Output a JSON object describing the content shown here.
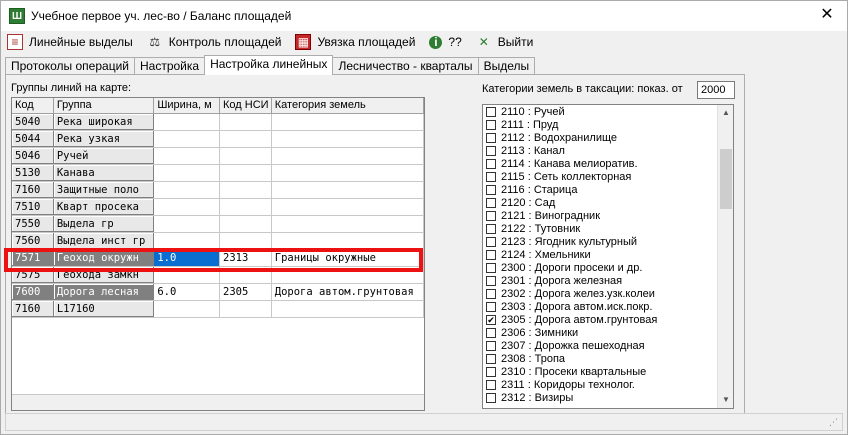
{
  "window": {
    "icon_text": "Ш",
    "title": "Учебное первое уч. лес-во / Баланс площадей",
    "close_glyph": "✕"
  },
  "toolbar": {
    "lines": "Линейные выделы",
    "control": "Контроль площадей",
    "tie": "Увязка площадей",
    "help": "??",
    "exit": "Выйти"
  },
  "tabs": [
    "Протоколы операций",
    "Настройка",
    "Настройка линейных",
    "Лесничество - кварталы",
    "Выделы"
  ],
  "groups_label": "Группы линий на карте:",
  "grid": {
    "headers": [
      "Код",
      "Группа",
      "Ширина, м",
      "Код НСИ",
      "Категория земель"
    ],
    "rows": [
      {
        "code": "5040",
        "group": "Река широкая",
        "width": "",
        "nsi": "",
        "category": ""
      },
      {
        "code": "5044",
        "group": "Река узкая",
        "width": "",
        "nsi": "",
        "category": ""
      },
      {
        "code": "5046",
        "group": "Ручей",
        "width": "",
        "nsi": "",
        "category": ""
      },
      {
        "code": "5130",
        "group": "Канава",
        "width": "",
        "nsi": "",
        "category": ""
      },
      {
        "code": "7160",
        "group": "Защитные поло",
        "width": "",
        "nsi": "",
        "category": ""
      },
      {
        "code": "7510",
        "group": "Кварт просека",
        "width": "",
        "nsi": "",
        "category": ""
      },
      {
        "code": "7550",
        "group": "Выдела гр",
        "width": "",
        "nsi": "",
        "category": ""
      },
      {
        "code": "7560",
        "group": "Выдела инст гр",
        "width": "",
        "nsi": "",
        "category": ""
      },
      {
        "code": "7571",
        "group": "Геоход окружн",
        "width": "1.0",
        "nsi": "2313",
        "category": "Границы окружные"
      },
      {
        "code": "7575",
        "group": "Геохода замкн",
        "width": "",
        "nsi": "",
        "category": ""
      },
      {
        "code": "7600",
        "group": "Дорога лесная",
        "width": "6.0",
        "nsi": "2305",
        "category": "Дорога автом.грунтовая"
      },
      {
        "code": "7160",
        "group": "L17160",
        "width": "",
        "nsi": "",
        "category": ""
      }
    ]
  },
  "categories_label": "Категории земель в таксации:  показ. от",
  "categories_from": "2000",
  "categories": [
    {
      "label": "2110 : Ручей",
      "checked": false
    },
    {
      "label": "2111 : Пруд",
      "checked": false
    },
    {
      "label": "2112 : Водохранилище",
      "checked": false
    },
    {
      "label": "2113 : Канал",
      "checked": false
    },
    {
      "label": "2114 : Канава мелиоратив.",
      "checked": false
    },
    {
      "label": "2115 : Сеть коллекторная",
      "checked": false
    },
    {
      "label": "2116 : Старица",
      "checked": false
    },
    {
      "label": "2120 : Сад",
      "checked": false
    },
    {
      "label": "2121 : Виноградник",
      "checked": false
    },
    {
      "label": "2122 : Тутовник",
      "checked": false
    },
    {
      "label": "2123 : Ягодник культурный",
      "checked": false
    },
    {
      "label": "2124 : Хмельники",
      "checked": false
    },
    {
      "label": "2300 : Дороги просеки и др.",
      "checked": false
    },
    {
      "label": "2301 : Дорога железная",
      "checked": false
    },
    {
      "label": "2302 : Дорога желез.узк.колеи",
      "checked": false
    },
    {
      "label": "2303 : Дорога автом.иск.покр.",
      "checked": false
    },
    {
      "label": "2305 : Дорога автом.грунтовая",
      "checked": true
    },
    {
      "label": "2306 : Зимники",
      "checked": false
    },
    {
      "label": "2307 : Дорожка пешеходная",
      "checked": false
    },
    {
      "label": "2308 : Тропа",
      "checked": false
    },
    {
      "label": "2310 : Просеки квартальные",
      "checked": false
    },
    {
      "label": "2311 : Коридоры технолог.",
      "checked": false
    },
    {
      "label": "2312 : Визиры",
      "checked": false
    }
  ],
  "colors": {
    "highlight": "#ee1111",
    "selection": "#0a6ed1"
  }
}
